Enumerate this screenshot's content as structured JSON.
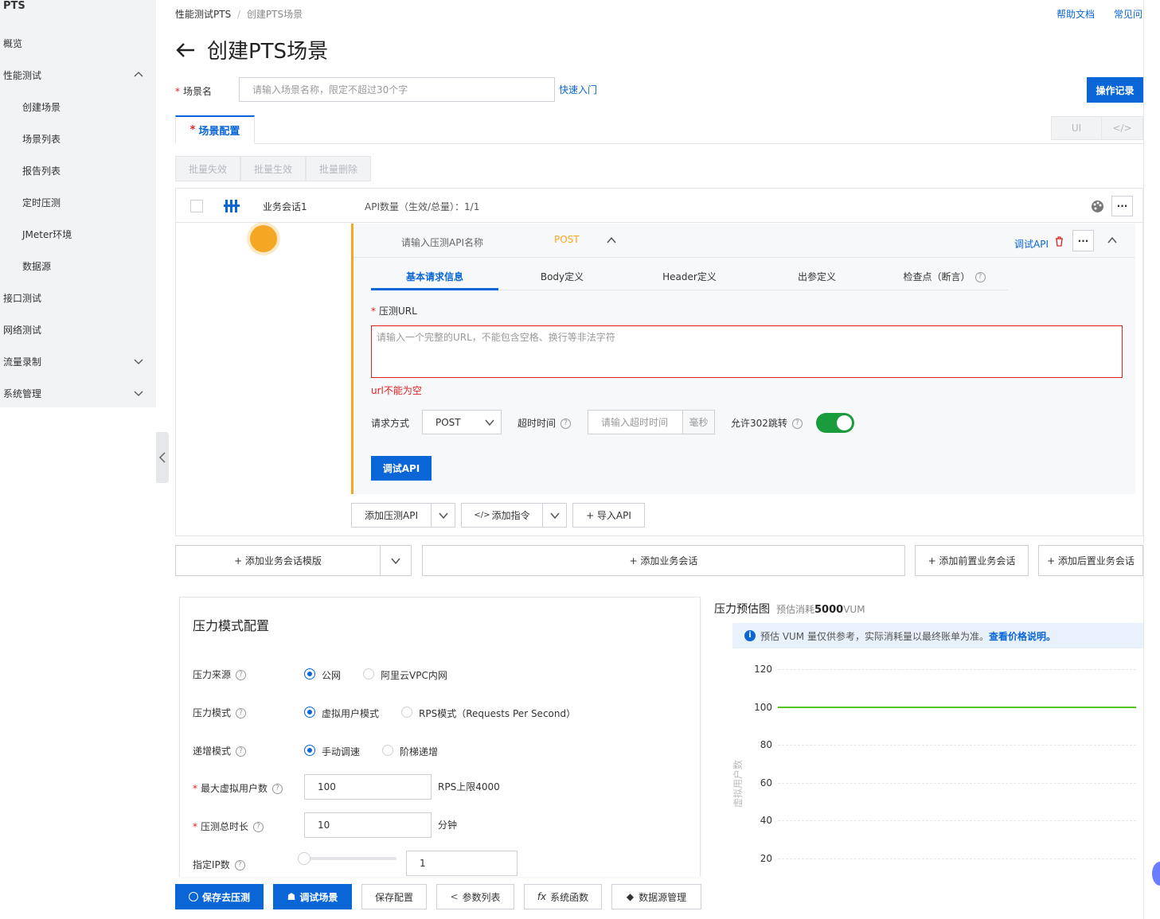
{
  "sidebar": {
    "brand": "PTS",
    "items": [
      {
        "label": "概览"
      },
      {
        "label": "性能测试"
      },
      {
        "label": "创建场景"
      },
      {
        "label": "场景列表"
      },
      {
        "label": "报告列表"
      },
      {
        "label": "定时压测"
      },
      {
        "label": "JMeter环境"
      },
      {
        "label": "数据源"
      },
      {
        "label": "接口测试"
      },
      {
        "label": "网络测试"
      },
      {
        "label": "流量录制"
      },
      {
        "label": "系统管理"
      }
    ]
  },
  "header": {
    "breadcrumb": [
      "性能测试PTS",
      "/",
      "创建PTS场景"
    ],
    "help_doc": "帮助文档",
    "faq": "常见问",
    "title": "创建PTS场景",
    "back_icon": "arrow-left-icon"
  },
  "scene": {
    "name_label": "场景名",
    "name_placeholder": "请输入场景名称，限定不超过30个字",
    "quick_start": "快速入门",
    "op_record": "操作记录"
  },
  "tabs": {
    "config": "场景配置",
    "ui": "UI",
    "code": "</>"
  },
  "batch": {
    "disable": "批量失效",
    "enable": "批量生效",
    "delete": "批量删除"
  },
  "session": {
    "name": "业务会话1",
    "api_count_label": "API数量（生效/总量）：",
    "api_count": "1/1"
  },
  "api": {
    "name_placeholder": "请输入压测API名称",
    "method_badge": "POST",
    "debug_link": "调试API",
    "sub_tabs": [
      "基本请求信息",
      "Body定义",
      "Header定义",
      "出参定义",
      "检查点（断言）"
    ],
    "url_label": "压测URL",
    "url_placeholder": "请输入一个完整的URL，不能包含空格、换行等非法字符",
    "url_error": "url不能为空",
    "method_label": "请求方式",
    "method_value": "POST",
    "timeout_label": "超时时间",
    "timeout_placeholder": "请输入超时时间",
    "timeout_unit": "毫秒",
    "redirect_label": "允许302跳转",
    "redirect_on": true,
    "debug_button": "调试API"
  },
  "api_actions": {
    "add_api": "添加压测API",
    "add_cmd": "添加指令",
    "import_api": "+ 导入API"
  },
  "session_actions": {
    "add_template": "+ 添加业务会话模版",
    "add_session": "+ 添加业务会话",
    "add_pre": "+ 添加前置业务会话",
    "add_post": "+ 添加后置业务会话"
  },
  "pressure": {
    "title": "压力模式配置",
    "source_label": "压力来源",
    "source_options": [
      "公网",
      "阿里云VPC内网"
    ],
    "source_selected": 0,
    "mode_label": "压力模式",
    "mode_options": [
      "虚拟用户模式",
      "RPS模式（Requests Per Second）"
    ],
    "mode_selected": 0,
    "ramp_label": "递增模式",
    "ramp_options": [
      "手动调速",
      "阶梯递增"
    ],
    "ramp_selected": 0,
    "max_users_label": "最大虚拟用户数",
    "max_users_value": "100",
    "rps_limit": "RPS上限4000",
    "duration_label": "压测总时长",
    "duration_value": "10",
    "duration_unit": "分钟",
    "ip_label": "指定IP数",
    "ip_value": "1",
    "ip_slider_level": 0
  },
  "estimate": {
    "title": "压力预估图",
    "cost_prefix": "预估消耗",
    "cost_value": "5000",
    "cost_unit": "VUM",
    "notice": "预估 VUM 量仅供参考，实际消耗量以最终账单为准。",
    "notice_link": "查看价格说明。"
  },
  "chart_data": {
    "type": "line",
    "title": "",
    "ylabel": "虚拟用户数",
    "ylim": [
      20,
      120
    ],
    "yticks": [
      120,
      100,
      80,
      60,
      40,
      20
    ],
    "series": [
      {
        "values": [
          100,
          100
        ]
      }
    ],
    "color": "#52c41a"
  },
  "footer": {
    "save_run": "保存去压测",
    "debug_scene": "调试场景",
    "save_config": "保存配置",
    "param_list": "参数列表",
    "sys_func": "系统函数",
    "datasource": "数据源管理"
  },
  "colors": {
    "primary": "#0a66d6",
    "warning": "#f5a623",
    "error": "#e02020",
    "toggle": "#1a9b3c"
  }
}
